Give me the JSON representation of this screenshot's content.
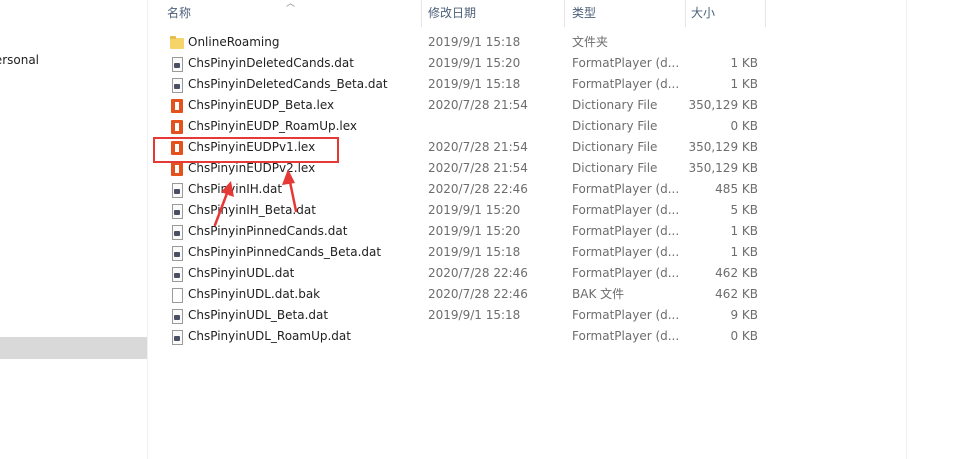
{
  "nav": {
    "partial_item_label": "Personal"
  },
  "columns": {
    "name": "名称",
    "date": "修改日期",
    "type": "类型",
    "size": "大小"
  },
  "files": [
    {
      "name": "OnlineRoaming",
      "date": "2019/9/1 15:18",
      "type": "文件夹",
      "size": "",
      "icon": "folder-icon"
    },
    {
      "name": "ChsPinyinDeletedCands.dat",
      "date": "2019/9/1 15:20",
      "type": "FormatPlayer (d...",
      "size": "1 KB",
      "icon": "dat-file-icon"
    },
    {
      "name": "ChsPinyinDeletedCands_Beta.dat",
      "date": "2019/9/1 15:18",
      "type": "FormatPlayer (d...",
      "size": "1 KB",
      "icon": "dat-file-icon"
    },
    {
      "name": "ChsPinyinEUDP_Beta.lex",
      "date": "2020/7/28 21:54",
      "type": "Dictionary File",
      "size": "350,129 KB",
      "icon": "office-file-icon"
    },
    {
      "name": "ChsPinyinEUDP_RoamUp.lex",
      "date": "",
      "type": "Dictionary File",
      "size": "0 KB",
      "icon": "office-file-icon"
    },
    {
      "name": "ChsPinyinEUDPv1.lex",
      "date": "2020/7/28 21:54",
      "type": "Dictionary File",
      "size": "350,129 KB",
      "icon": "office-file-icon"
    },
    {
      "name": "ChsPinyinEUDPv2.lex",
      "date": "2020/7/28 21:54",
      "type": "Dictionary File",
      "size": "350,129 KB",
      "icon": "office-file-icon"
    },
    {
      "name": "ChsPinyinIH.dat",
      "date": "2020/7/28 22:46",
      "type": "FormatPlayer (d...",
      "size": "485 KB",
      "icon": "dat-file-icon"
    },
    {
      "name": "ChsPinyinIH_Beta.dat",
      "date": "2019/9/1 15:20",
      "type": "FormatPlayer (d...",
      "size": "5 KB",
      "icon": "dat-file-icon"
    },
    {
      "name": "ChsPinyinPinnedCands.dat",
      "date": "2019/9/1 15:20",
      "type": "FormatPlayer (d...",
      "size": "1 KB",
      "icon": "dat-file-icon"
    },
    {
      "name": "ChsPinyinPinnedCands_Beta.dat",
      "date": "2019/9/1 15:18",
      "type": "FormatPlayer (d...",
      "size": "1 KB",
      "icon": "dat-file-icon"
    },
    {
      "name": "ChsPinyinUDL.dat",
      "date": "2020/7/28 22:46",
      "type": "FormatPlayer (d...",
      "size": "462 KB",
      "icon": "dat-file-icon"
    },
    {
      "name": "ChsPinyinUDL.dat.bak",
      "date": "2020/7/28 22:46",
      "type": "BAK 文件",
      "size": "462 KB",
      "icon": "bak-file-icon"
    },
    {
      "name": "ChsPinyinUDL_Beta.dat",
      "date": "2019/9/1 15:18",
      "type": "FormatPlayer (d...",
      "size": "9 KB",
      "icon": "dat-file-icon"
    },
    {
      "name": "ChsPinyinUDL_RoamUp.dat",
      "date": "",
      "type": "FormatPlayer (d...",
      "size": "0 KB",
      "icon": "dat-file-icon"
    }
  ],
  "annotation": {
    "color": "#e53935",
    "highlighted_file": "ChsPinyinEUDPv1.lex"
  }
}
